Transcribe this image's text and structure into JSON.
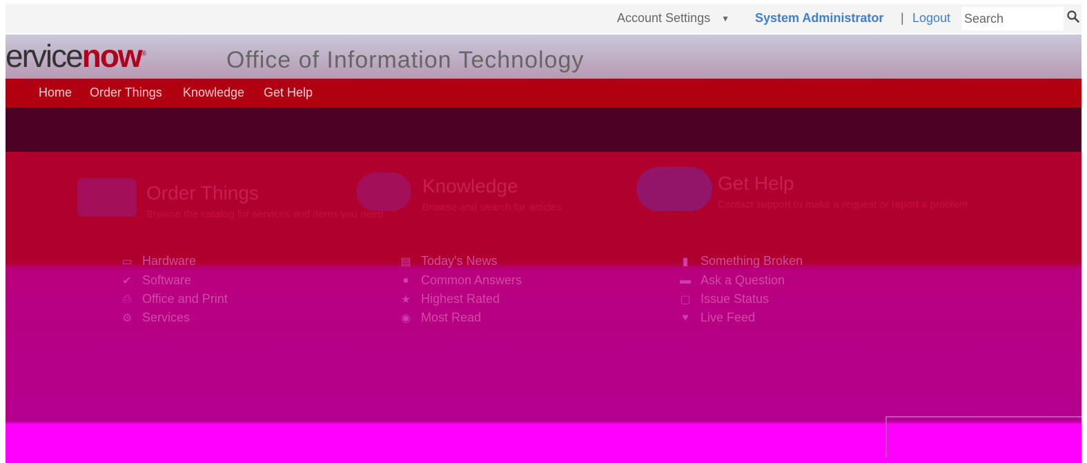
{
  "topbar": {
    "account_settings": "Account Settings",
    "user": "System Administrator",
    "separator": "|",
    "logout": "Logout",
    "search_placeholder": "Search"
  },
  "brand": {
    "logo_text_a": "ervice",
    "logo_text_b": "now",
    "title": "Office of Information Technology"
  },
  "nav": {
    "items": [
      "Home",
      "Order Things",
      "Knowledge",
      "Get Help"
    ]
  },
  "panels": [
    {
      "title": "Order Things",
      "description": "Browse the catalog for services and items you need",
      "links": [
        {
          "icon": "laptop-icon",
          "label": "Hardware"
        },
        {
          "icon": "check-icon",
          "label": "Software"
        },
        {
          "icon": "printer-icon",
          "label": "Office and Print"
        },
        {
          "icon": "gear-icon",
          "label": "Services"
        }
      ]
    },
    {
      "title": "Knowledge",
      "description": "Browse and search for articles",
      "links": [
        {
          "icon": "newspaper-icon",
          "label": "Today's News"
        },
        {
          "icon": "question-icon",
          "label": "Common Answers"
        },
        {
          "icon": "star-icon",
          "label": "Highest Rated"
        },
        {
          "icon": "eye-icon",
          "label": "Most Read"
        }
      ]
    },
    {
      "title": "Get Help",
      "description": "Contact support to make a request or report a problem",
      "links": [
        {
          "icon": "broken-icon",
          "label": "Something Broken"
        },
        {
          "icon": "chat-icon",
          "label": "Ask a Question"
        },
        {
          "icon": "clipboard-icon",
          "label": "Issue Status"
        },
        {
          "icon": "feed-icon",
          "label": "Live Feed"
        }
      ]
    }
  ]
}
